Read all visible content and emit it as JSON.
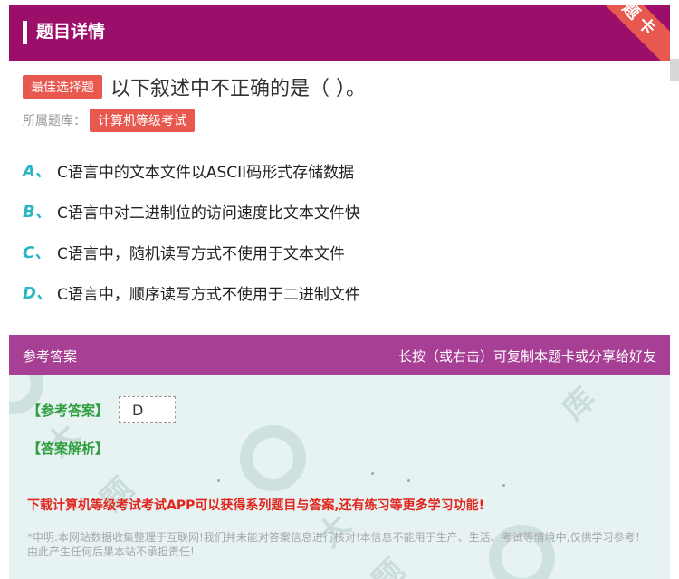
{
  "header": {
    "title": "题目详情",
    "ribbon": "题卡"
  },
  "question": {
    "tag": "最佳选择题",
    "text": "以下叙述中不正确的是（    ）。",
    "library_label": "所属题库：",
    "library": "计算机等级考试"
  },
  "options": [
    {
      "letter": "A、",
      "text": "C语言中的文本文件以ASCII码形式存储数据"
    },
    {
      "letter": "B、",
      "text": "C语言中对二进制位的访问速度比文本文件快"
    },
    {
      "letter": "C、",
      "text": "C语言中，随机读写方式不使用于文本文件"
    },
    {
      "letter": "D、",
      "text": "C语言中，顺序读写方式不使用于二进制文件"
    }
  ],
  "answer": {
    "header_left": "参考答案",
    "header_right": "长按（或右击）可复制本题卡或分享给好友",
    "label": "【参考答案】",
    "value": "D",
    "analysis_label": "【答案解析】",
    "promo": "下载计算机等级考试考试APP可以获得系列题目与答案,还有练习等更多学习功能!",
    "disclaimer": "*申明:本网站数据收集整理于互联网!我们并未能对答案信息进行核对!本信息不能用于生产、生活、考试等情境中,仅供学习参考！由此产生任何后果本站不承担责任!"
  },
  "colors": {
    "header_bg": "#9b0e6a",
    "tag_bg": "#e8584f",
    "option_letter": "#29b6c3",
    "answer_header_bg": "#a73f95",
    "answer_label": "#2e9e3f",
    "promo": "#e0261e"
  }
}
